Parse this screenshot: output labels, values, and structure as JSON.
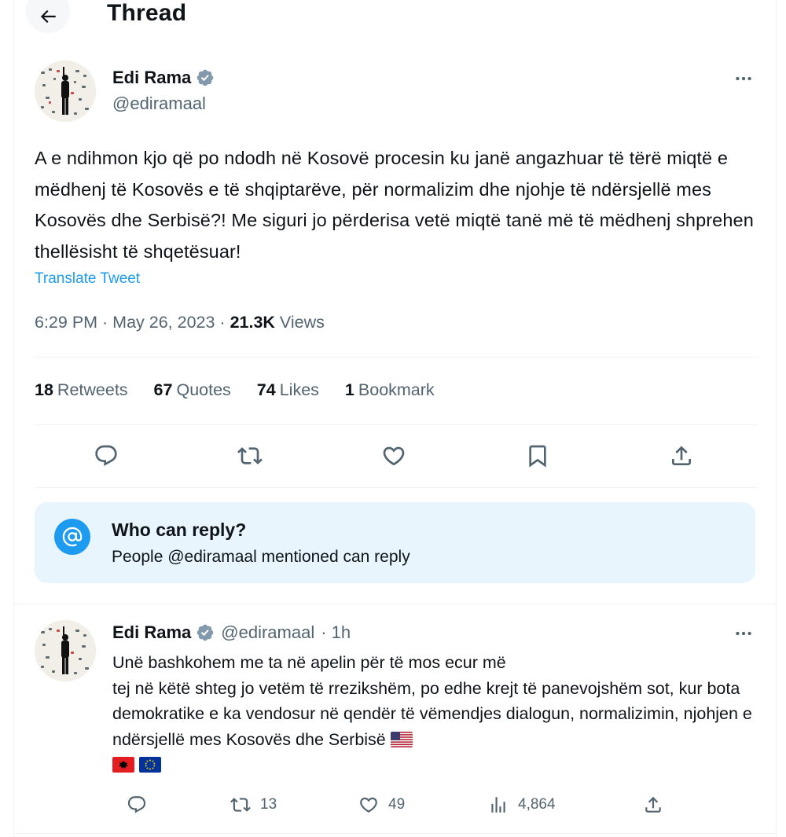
{
  "header": {
    "title": "Thread",
    "back_icon": "arrow-left-icon"
  },
  "main_tweet": {
    "author": {
      "name": "Edi Rama",
      "handle": "@ediramaal"
    },
    "text": "A e ndihmon kjo që po ndodh në Kosovë procesin ku janë angazhuar të tërë miqtë e mëdhenj të Kosovës e të shqiptarëve, për normalizim dhe njohje të ndërsjellë mes Kosovës dhe Serbisë?! Me siguri jo përderisa vetë miqtë tanë më të mëdhenj shprehen thellësisht të shqetësuar!",
    "translate_label": "Translate Tweet",
    "time": "6:29 PM · May 26, 2023 · ",
    "views_count": "21.3K",
    "views_label": " Views",
    "stats": {
      "retweets": {
        "count": "18",
        "label": "Retweets"
      },
      "quotes": {
        "count": "67",
        "label": "Quotes"
      },
      "likes": {
        "count": "74",
        "label": "Likes"
      },
      "bookmarks": {
        "count": "1",
        "label": "Bookmark"
      }
    }
  },
  "who_can_reply": {
    "title": "Who can reply?",
    "subtitle": "People @ediramaal mentioned can reply"
  },
  "reply_tweet": {
    "author": {
      "name": "Edi Rama",
      "handle": "@ediramaal",
      "time": "· 1h"
    },
    "text_line1": "Unë bashkohem me ta në apelin për të mos ecur më",
    "text_rest": "tej në këtë shteg jo vetëm të rrezikshëm, po edhe krejt të panevojshëm sot, kur bota demokratike e ka vendosur në qendër të vëmendjes dialogun, normalizimin, njohjen e ndërsjellë mes Kosovës dhe Serbisë ",
    "stats": {
      "replies": "",
      "retweets": "13",
      "likes": "49",
      "views": "4,864"
    }
  },
  "colors": {
    "accent": "#1d9bf0",
    "text": "#0f1419",
    "muted": "#536471",
    "divider": "#eff3f4",
    "reply_box": "#e8f5fd"
  }
}
